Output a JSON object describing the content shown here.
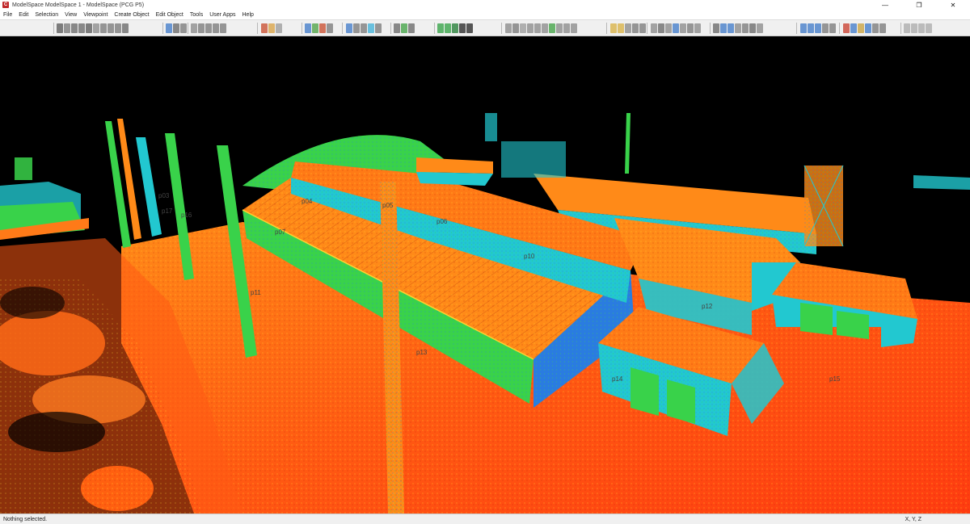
{
  "window": {
    "title": "ModelSpace ModelSpace 1 - ModelSpace (PCG P5)",
    "minimize_glyph": "—",
    "maximize_glyph": "❐",
    "close_glyph": "✕",
    "app_icon": "cyclone-app-icon"
  },
  "menu": [
    "File",
    "Edit",
    "Selection",
    "View",
    "Viewpoint",
    "Create Object",
    "Edit Object",
    "Tools",
    "User Apps",
    "Help"
  ],
  "viewport": {
    "background": "#000000",
    "labels": [
      "p03",
      "p04",
      "p05",
      "p06",
      "p07",
      "p10",
      "p11",
      "p12",
      "p13",
      "p14",
      "p15",
      "p16",
      "p17"
    ]
  },
  "status": {
    "text": "Nothing selected.",
    "coords": "X, Y, Z"
  },
  "colors": {
    "accent": "#c0292b",
    "cloud_red": "#ff3c12",
    "cloud_orange": "#ff7a14",
    "cloud_yellow": "#e8e020",
    "cloud_green": "#39d24a",
    "cloud_cyan": "#22c8d0",
    "cloud_blue": "#2a7ce0"
  }
}
